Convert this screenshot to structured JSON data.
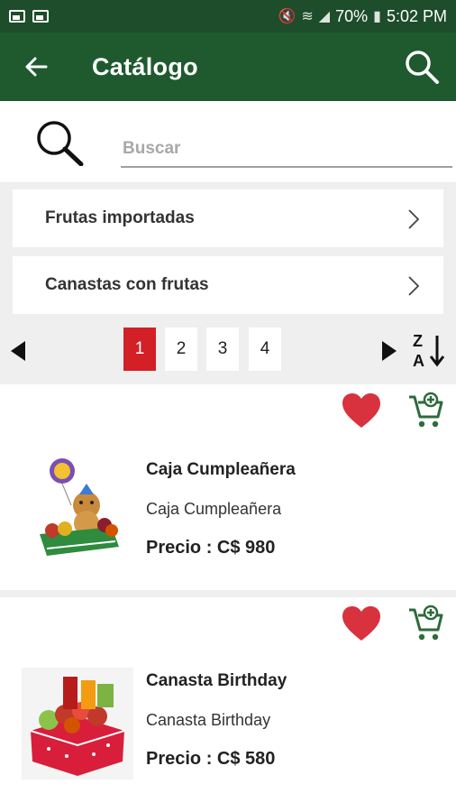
{
  "status_bar": {
    "battery": "70%",
    "time": "5:02 PM"
  },
  "app_bar": {
    "title": "Catálogo",
    "back_icon": "arrow-back-icon",
    "search_icon": "search-icon"
  },
  "search": {
    "placeholder": "Buscar"
  },
  "categories": [
    {
      "label": "Frutas importadas"
    },
    {
      "label": "Canastas con frutas"
    }
  ],
  "pagination": {
    "pages": [
      "1",
      "2",
      "3",
      "4"
    ],
    "active_page": "1",
    "sort_icon": "sort-z-a-icon"
  },
  "products": [
    {
      "name": "Caja Cumpleañera",
      "description": "Caja Cumpleañera",
      "price": "Precio : C$ 980"
    },
    {
      "name": "Canasta Birthday",
      "description": "Canasta Birthday",
      "price": "Precio : C$ 580"
    }
  ],
  "colors": {
    "status_bar": "#1d4d2a",
    "app_bar": "#1f5a2e",
    "active_page": "#d32027",
    "heart": "#d8323f",
    "cart": "#2e6b3b",
    "background": "#efefef"
  }
}
